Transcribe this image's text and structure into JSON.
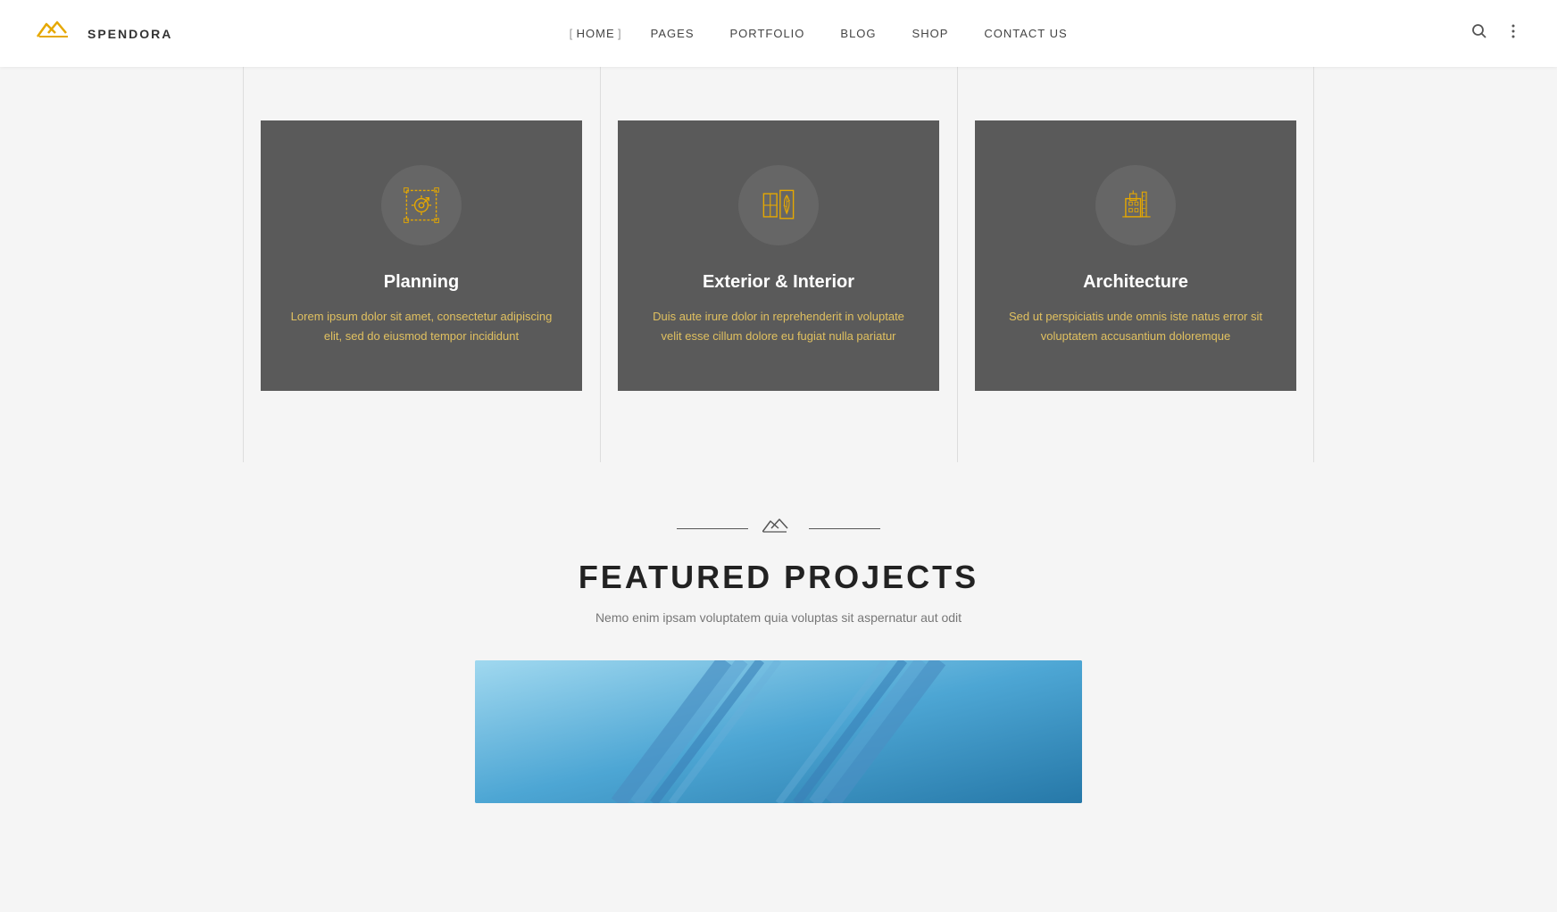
{
  "brand": {
    "name": "SPENDORA",
    "logo_alt": "Spendora logo"
  },
  "nav": {
    "items": [
      {
        "label": "HOME",
        "active": true
      },
      {
        "label": "PAGES",
        "active": false
      },
      {
        "label": "PORTFOLIO",
        "active": false
      },
      {
        "label": "BLOG",
        "active": false
      },
      {
        "label": "SHOP",
        "active": false
      },
      {
        "label": "CONTACT US",
        "active": false
      }
    ]
  },
  "services": {
    "cards": [
      {
        "title": "Planning",
        "desc": "Lorem ipsum dolor sit amet, consectetur adipiscing elit, sed do eiusmod tempor incididunt",
        "icon": "planning"
      },
      {
        "title": "Exterior & Interior",
        "desc": "Duis aute irure dolor in reprehenderit in voluptate velit esse cillum dolore eu fugiat nulla pariatur",
        "icon": "exterior"
      },
      {
        "title": "Architecture",
        "desc": "Sed ut perspiciatis unde omnis iste natus error sit voluptatem accusantium doloremque",
        "icon": "architecture"
      }
    ]
  },
  "featured": {
    "title": "FEATURED PROJECTS",
    "subtitle": "Nemo enim ipsam voluptatem quia voluptas sit aspernatur aut odit"
  }
}
